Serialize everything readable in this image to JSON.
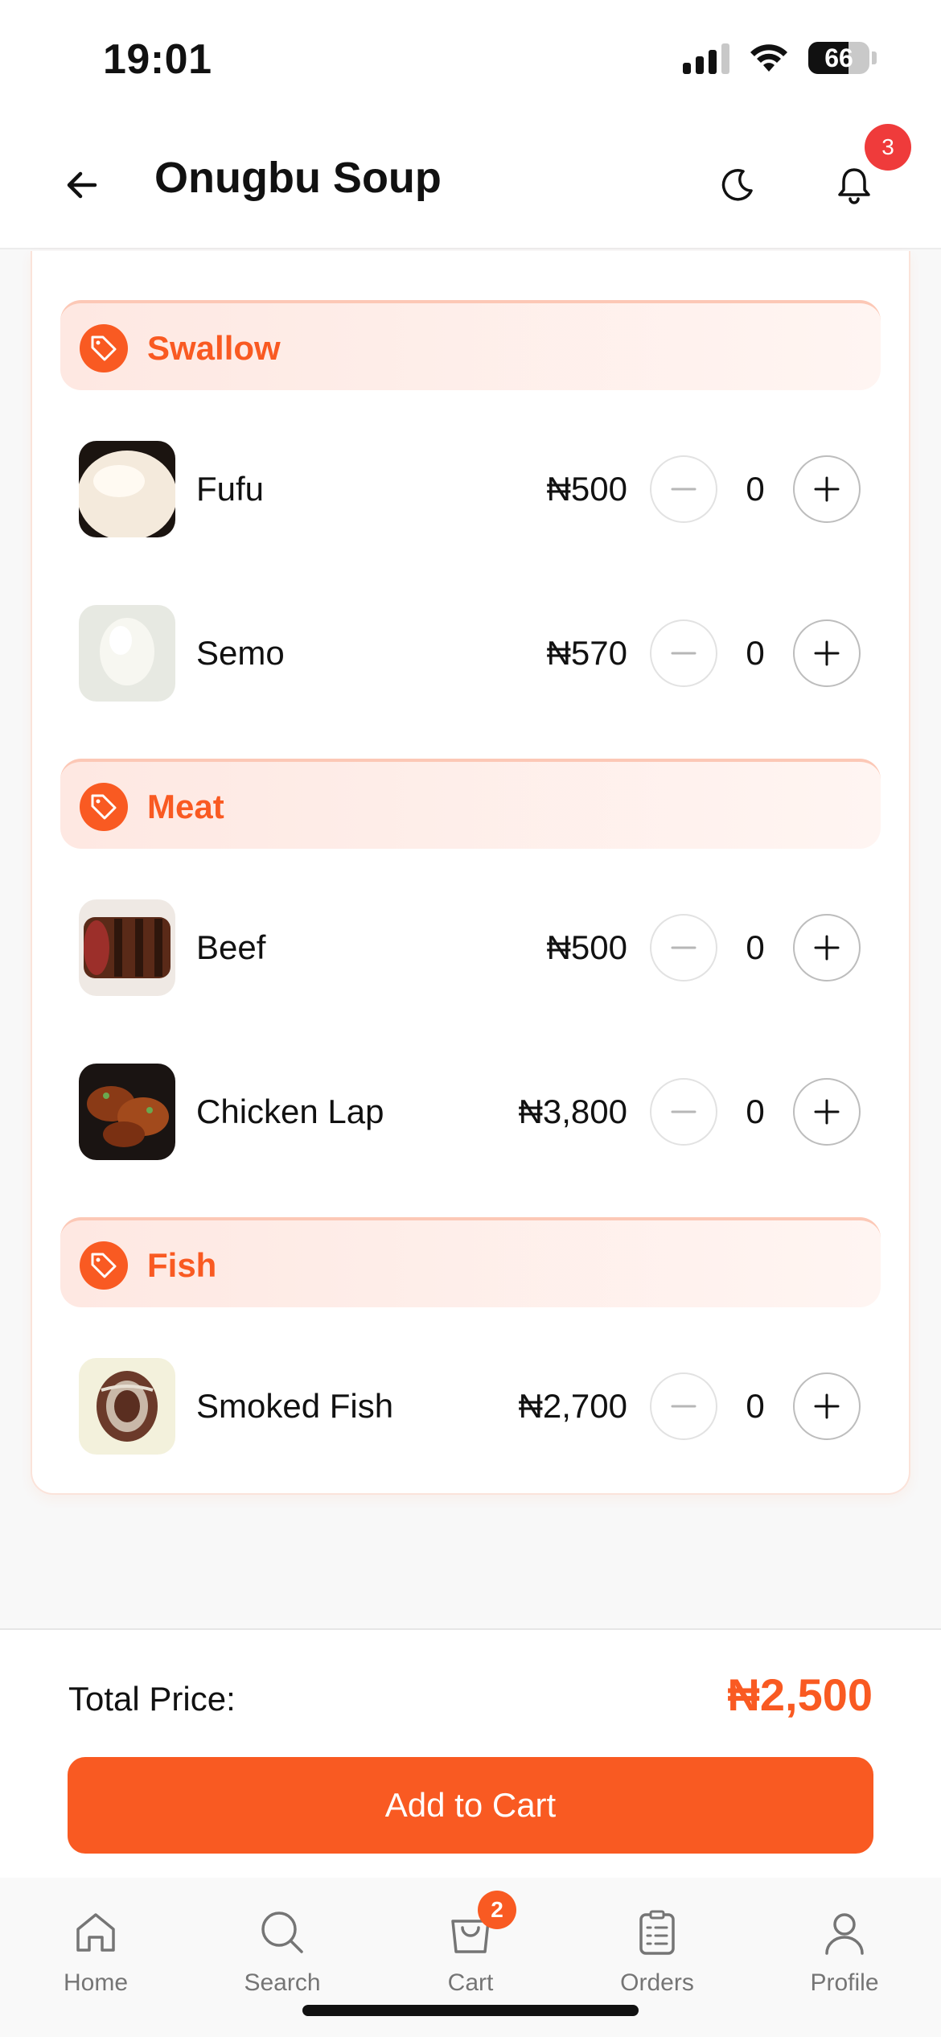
{
  "status_bar": {
    "time": "19:01",
    "battery": "66"
  },
  "header": {
    "title": "Onugbu Soup",
    "notification_count": "3"
  },
  "categories": [
    {
      "label": "Swallow",
      "items": [
        {
          "name": "Fufu",
          "price": "₦500",
          "qty": "0"
        },
        {
          "name": "Semo",
          "price": "₦570",
          "qty": "0"
        }
      ]
    },
    {
      "label": "Meat",
      "items": [
        {
          "name": "Beef",
          "price": "₦500",
          "qty": "0"
        },
        {
          "name": "Chicken Lap",
          "price": "₦3,800",
          "qty": "0"
        }
      ]
    },
    {
      "label": "Fish",
      "items": [
        {
          "name": "Smoked Fish",
          "price": "₦2,700",
          "qty": "0"
        }
      ]
    }
  ],
  "summary": {
    "total_label": "Total Price:",
    "total_value": "₦2,500",
    "add_to_cart": "Add to Cart"
  },
  "tabbar": {
    "tabs": [
      {
        "label": "Home",
        "icon": "home-icon"
      },
      {
        "label": "Search",
        "icon": "search-icon"
      },
      {
        "label": "Cart",
        "icon": "cart-icon"
      },
      {
        "label": "Orders",
        "icon": "orders-icon"
      },
      {
        "label": "Profile",
        "icon": "profile-icon"
      }
    ],
    "cart_badge": "2"
  },
  "colors": {
    "accent": "#f95a22",
    "badge_red": "#ef3b3b",
    "category_bg": "#fee8e2"
  }
}
